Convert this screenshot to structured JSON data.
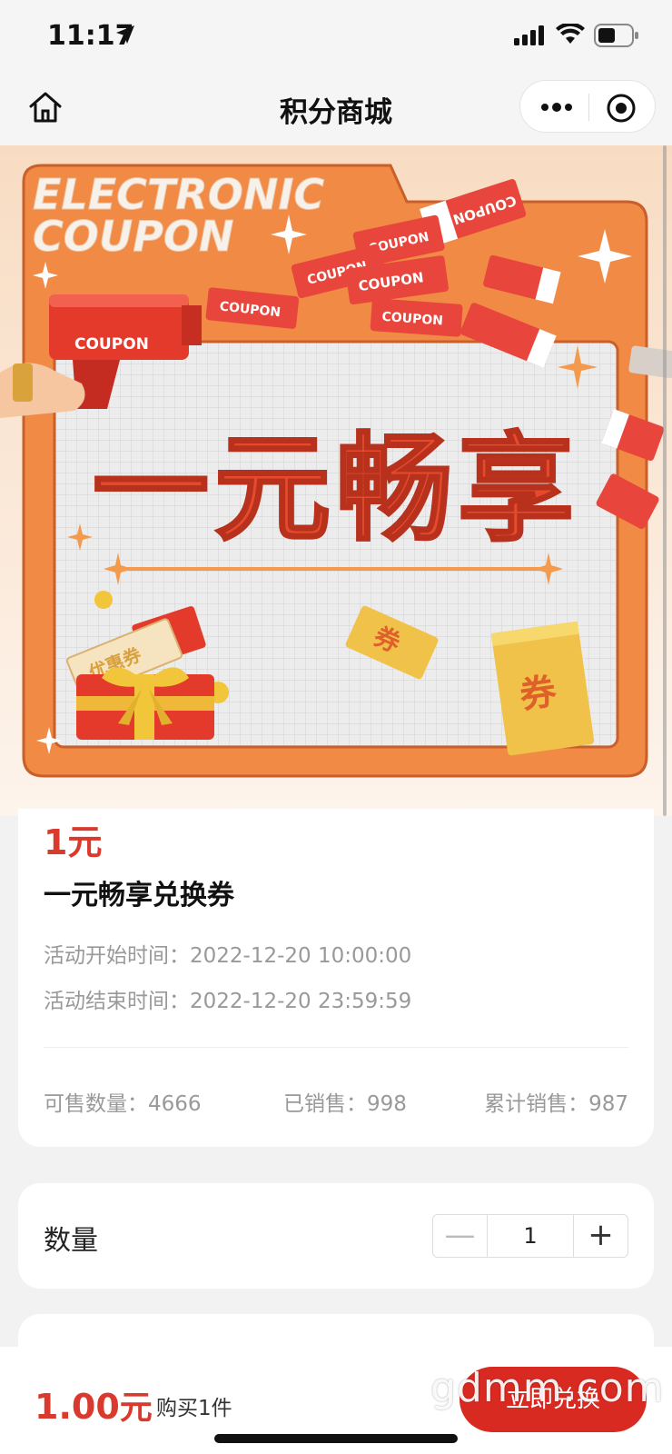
{
  "status_bar": {
    "time": "11:17"
  },
  "nav": {
    "title": "积分商城"
  },
  "banner": {
    "headline_line1": "ELECTRONIC",
    "headline_line2": "COUPON",
    "gun_label": "COUPON",
    "ticket_label": "COUPON",
    "main_text": "一元畅享",
    "gift_tag": "优惠券",
    "quan_char": "券",
    "colors": {
      "frame": "#f08a45",
      "text_red": "#e54a2c",
      "grid_bg": "#ececec"
    }
  },
  "product": {
    "price": "1元",
    "name": "一元畅享兑换券",
    "start_label": "活动开始时间：",
    "start_time": "2022-12-20 10:00:00",
    "end_label": "活动结束时间：",
    "end_time": "2022-12-20 23:59:59",
    "stats": [
      {
        "label": "可售数量：",
        "value": "4666"
      },
      {
        "label": "已销售：",
        "value": "998"
      },
      {
        "label": "累计销售：",
        "value": "987"
      }
    ]
  },
  "quantity": {
    "label": "数量",
    "minus": "—",
    "value": "1",
    "plus": "+"
  },
  "bottom_bar": {
    "price_value": "1.00",
    "price_unit": "元",
    "count_text": "购买1件",
    "buy_label": "立即兑换",
    "watermark": "gdmm.com"
  }
}
